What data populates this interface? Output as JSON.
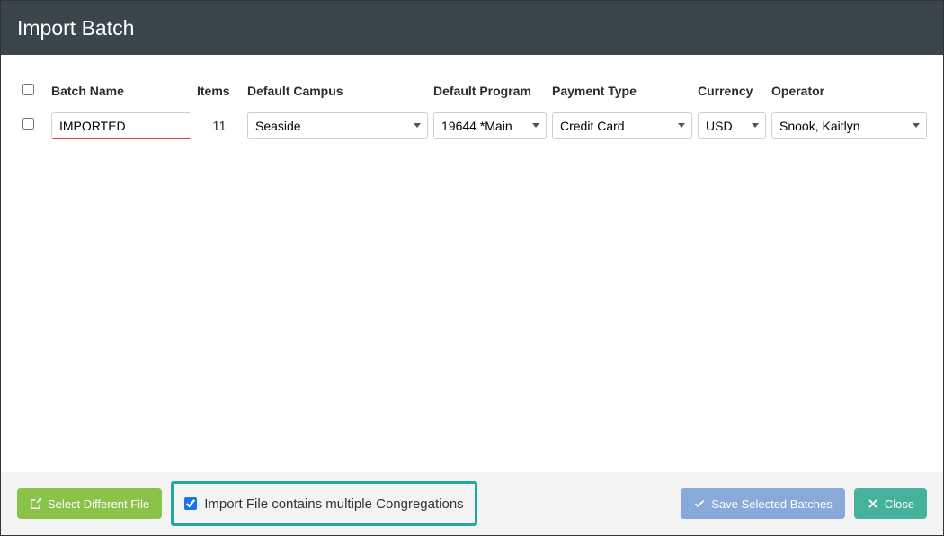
{
  "header": {
    "title": "Import Batch"
  },
  "columns": {
    "check": "",
    "batch_name": "Batch Name",
    "items": "Items",
    "default_campus": "Default Campus",
    "default_program": "Default Program",
    "payment_type": "Payment Type",
    "currency": "Currency",
    "operator": "Operator"
  },
  "rows": [
    {
      "checked": false,
      "batch_name": "IMPORTED",
      "items": "11",
      "default_campus": "Seaside",
      "default_program": "19644 *Main",
      "payment_type": "Credit Card",
      "currency": "USD",
      "operator": "Snook, Kaitlyn"
    }
  ],
  "footer": {
    "select_different_file": "Select Different File",
    "multi_congregations_checked": true,
    "multi_congregations_label": "Import File contains multiple Congregations",
    "save_selected": "Save Selected Batches",
    "close": "Close"
  }
}
